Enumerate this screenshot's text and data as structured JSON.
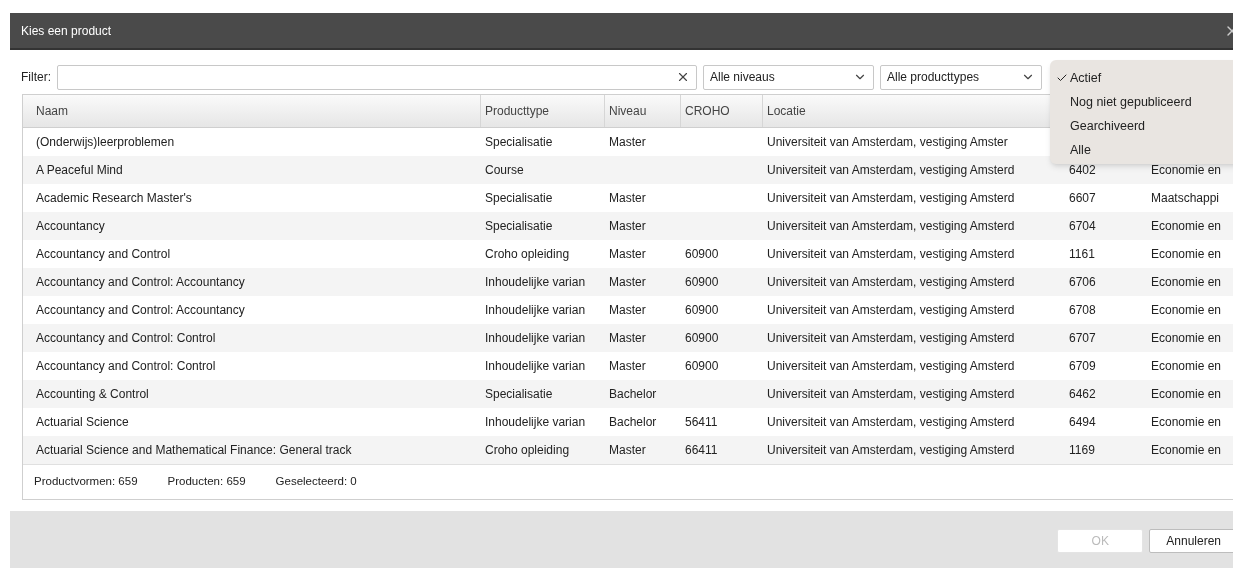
{
  "dialog": {
    "title": "Kies een product"
  },
  "filter": {
    "label": "Filter:"
  },
  "selects": [
    {
      "value": "Alle niveaus"
    },
    {
      "value": "Alle producttypes"
    }
  ],
  "status_menu": [
    {
      "label": "Actief",
      "selected": true
    },
    {
      "label": "Nog niet gepubliceerd",
      "selected": false
    },
    {
      "label": "Gearchiveerd",
      "selected": false
    },
    {
      "label": "Alle",
      "selected": false
    }
  ],
  "table": {
    "columns": [
      "Naam",
      "Producttype",
      "Niveau",
      "CROHO",
      "Locatie"
    ],
    "rows": [
      {
        "naam": "(Onderwijs)leerproblemen",
        "producttype": "Specialisatie",
        "niveau": "Master",
        "locatie": "Universiteit van Amsterdam, vestiging Amster"
      },
      {
        "naam": "A Peaceful Mind",
        "producttype": "Course",
        "locatie": "Universiteit van Amsterdam, vestiging Amsterd",
        "column_6": "6402",
        "column_7": "Economie en"
      },
      {
        "naam": "Academic Research Master's",
        "producttype": "Specialisatie",
        "niveau": "Master",
        "locatie": "Universiteit van Amsterdam, vestiging Amsterd",
        "column_6": "6607",
        "column_7": "Maatschappi"
      },
      {
        "naam": "Accountancy",
        "producttype": "Specialisatie",
        "niveau": "Master",
        "locatie": "Universiteit van Amsterdam, vestiging Amsterd",
        "column_6": "6704",
        "column_7": "Economie en"
      },
      {
        "naam": "Accountancy and Control",
        "producttype": "Croho opleiding",
        "niveau": "Master",
        "croho": "60900",
        "locatie": "Universiteit van Amsterdam, vestiging Amsterd",
        "column_6": "1161",
        "column_7": "Economie en"
      },
      {
        "naam": "Accountancy and Control: Accountancy",
        "producttype": "Inhoudelijke varian",
        "niveau": "Master",
        "croho": "60900",
        "locatie": "Universiteit van Amsterdam, vestiging Amsterd",
        "column_6": "6706",
        "column_7": "Economie en"
      },
      {
        "naam": "Accountancy and Control: Accountancy",
        "producttype": "Inhoudelijke varian",
        "niveau": "Master",
        "croho": "60900",
        "locatie": "Universiteit van Amsterdam, vestiging Amsterd",
        "column_6": "6708",
        "column_7": "Economie en"
      },
      {
        "naam": "Accountancy and Control: Control",
        "producttype": "Inhoudelijke varian",
        "niveau": "Master",
        "croho": "60900",
        "locatie": "Universiteit van Amsterdam, vestiging Amsterd",
        "column_6": "6707",
        "column_7": "Economie en"
      },
      {
        "naam": "Accountancy and Control: Control",
        "producttype": "Inhoudelijke varian",
        "niveau": "Master",
        "croho": "60900",
        "locatie": "Universiteit van Amsterdam, vestiging Amsterd",
        "column_6": "6709",
        "column_7": "Economie en"
      },
      {
        "naam": "Accounting & Control",
        "producttype": "Specialisatie",
        "niveau": "Bachelor",
        "locatie": "Universiteit van Amsterdam, vestiging Amsterd",
        "column_6": "6462",
        "column_7": "Economie en"
      },
      {
        "naam": "Actuarial Science",
        "producttype": "Inhoudelijke varian",
        "niveau": "Bachelor",
        "croho": "56411",
        "locatie": "Universiteit van Amsterdam, vestiging Amsterd",
        "column_6": "6494",
        "column_7": "Economie en"
      },
      {
        "naam": "Actuarial Science and Mathematical Finance: General track",
        "producttype": "Croho opleiding",
        "niveau": "Master",
        "croho": "66411",
        "locatie": "Universiteit van Amsterdam, vestiging Amsterd",
        "column_6": "1169",
        "column_7": "Economie en"
      }
    ]
  },
  "footer": [
    "Productvormen: 659",
    "Producten: 659",
    "Geselecteerd: 0"
  ],
  "buttons": [
    {
      "label": "OK",
      "disabled": true
    },
    {
      "label": "Annuleren",
      "disabled": false
    }
  ]
}
